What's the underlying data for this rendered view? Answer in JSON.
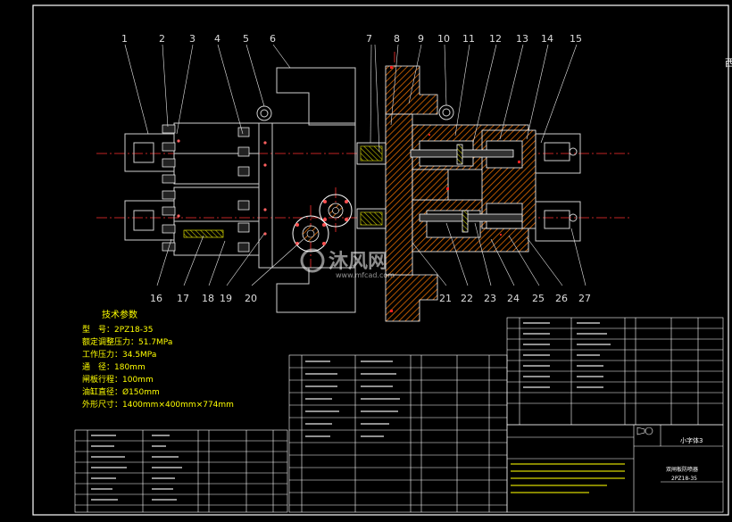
{
  "part_numbers": [
    "1",
    "2",
    "3",
    "4",
    "5",
    "6",
    "7",
    "8",
    "9",
    "10",
    "11",
    "12",
    "13",
    "14",
    "15",
    "16",
    "17",
    "18",
    "19",
    "20",
    "21",
    "22",
    "23",
    "24",
    "25",
    "26",
    "27"
  ],
  "technical_params": {
    "title": "技术参数",
    "lines": [
      "型　号：2PZ18-35",
      "额定调整压力：51.7MPa",
      "工作压力：34.5MPa",
      "通　径：180mm",
      "闸板行程：100mm",
      "油缸直径：Ø150mm",
      "外形尺寸：1400mm×400mm×774mm"
    ]
  },
  "title_block": {
    "company": "小字体3",
    "drawing_name": "双闸板防喷器",
    "drawing_code": "2PZ18-35"
  },
  "watermark": {
    "brand": "沐风网",
    "url": "www.mfcad.com"
  },
  "corner_text": "西"
}
